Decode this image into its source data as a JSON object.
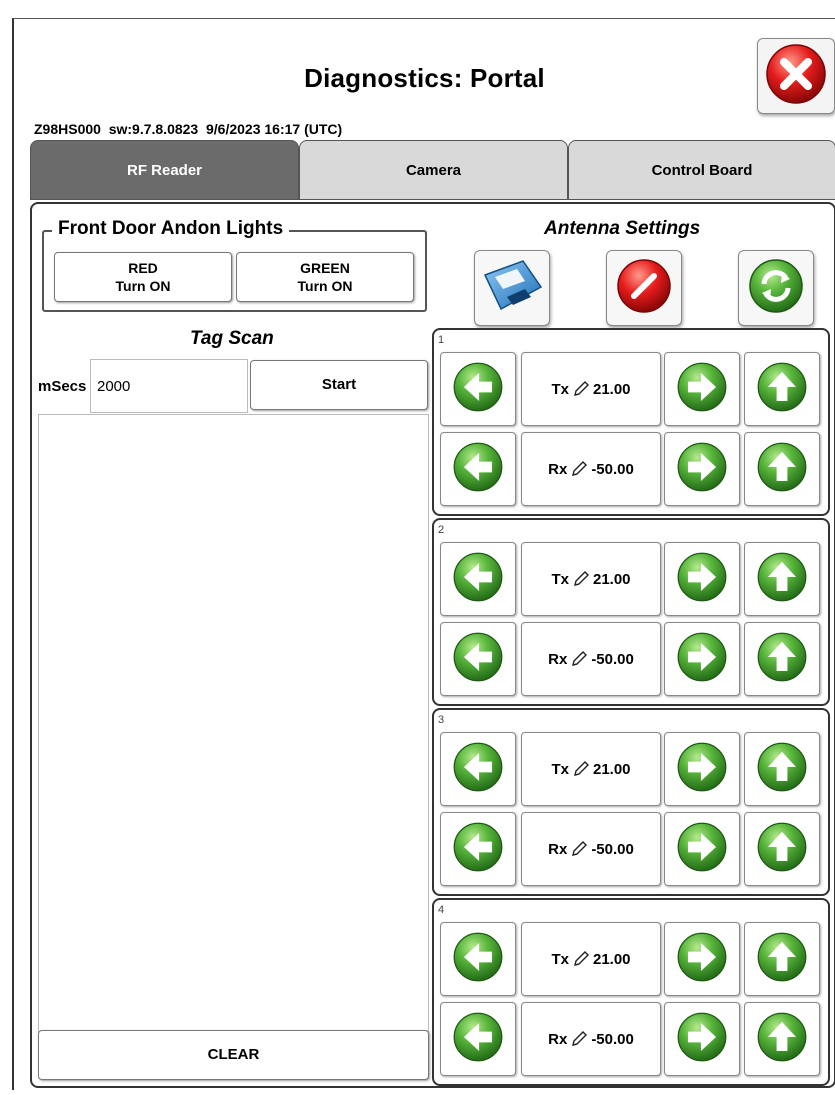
{
  "window": {
    "title": "Diagnostics: Portal",
    "info": "Z98HS000  sw:9.7.8.0823  9/6/2023 16:17 (UTC)"
  },
  "tabs": [
    {
      "label": "RF Reader",
      "active": true
    },
    {
      "label": "Camera",
      "active": false
    },
    {
      "label": "Control Board",
      "active": false
    }
  ],
  "andon": {
    "legend": "Front Door Andon Lights",
    "red_line1": "RED",
    "red_line2": "Turn ON",
    "green_line1": "GREEN",
    "green_line2": "Turn ON"
  },
  "tag_scan": {
    "title": "Tag Scan",
    "msecs_label": "mSecs",
    "msecs_value": "2000",
    "start_label": "Start",
    "clear_label": "CLEAR"
  },
  "antenna_settings": {
    "title": "Antenna Settings",
    "icons": [
      "save-icon",
      "cancel-icon",
      "refresh-icon"
    ],
    "antennas": [
      {
        "number": "1",
        "tx_label": "Tx",
        "tx_value": "21.00",
        "rx_label": "Rx",
        "rx_value": "-50.00"
      },
      {
        "number": "2",
        "tx_label": "Tx",
        "tx_value": "21.00",
        "rx_label": "Rx",
        "rx_value": "-50.00"
      },
      {
        "number": "3",
        "tx_label": "Tx",
        "tx_value": "21.00",
        "rx_label": "Rx",
        "rx_value": "-50.00"
      },
      {
        "number": "4",
        "tx_label": "Tx",
        "tx_value": "21.00",
        "rx_label": "Rx",
        "rx_value": "-50.00"
      }
    ]
  },
  "colors": {
    "active_tab": "#6b6b6b",
    "inactive_tab": "#d9d9d9",
    "arrow_green": "#3f9e2f",
    "close_red": "#d41818"
  }
}
